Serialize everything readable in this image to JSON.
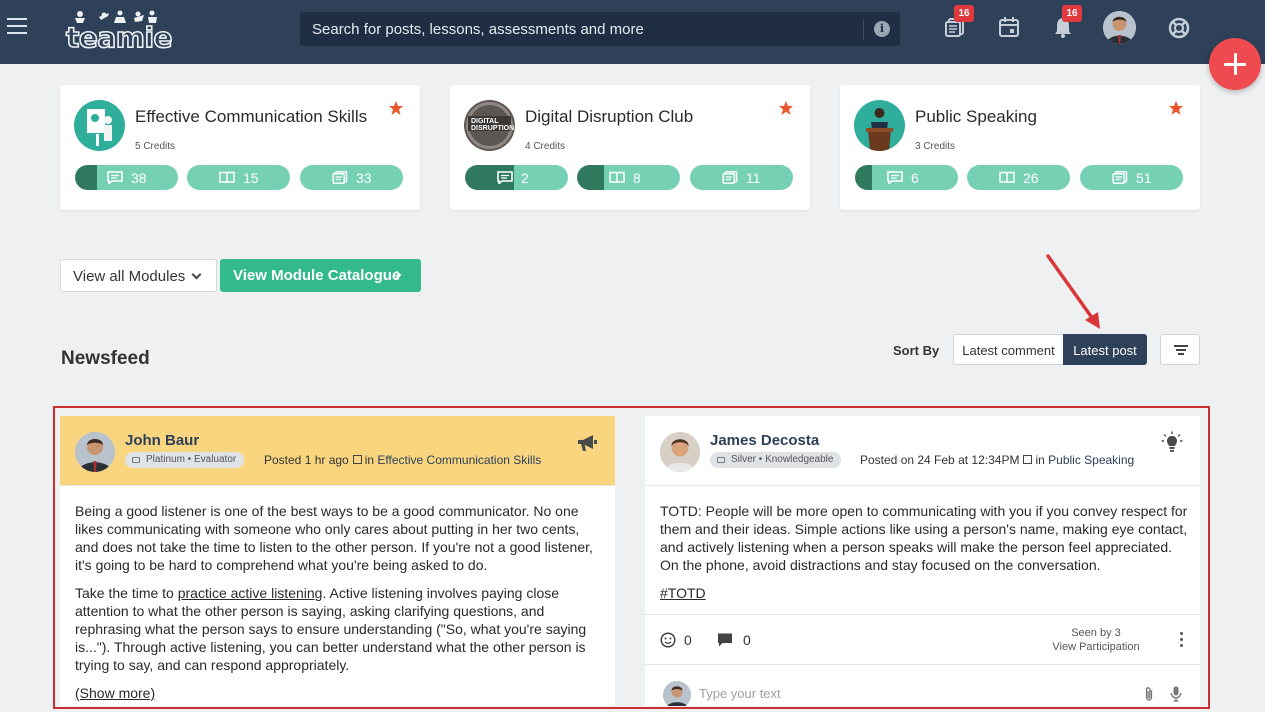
{
  "app": {
    "logo_text": "teamie"
  },
  "topbar": {
    "search_placeholder": "Search for posts, lessons, assessments and more",
    "posts_badge": "16",
    "notifications_badge": "16"
  },
  "modules": [
    {
      "title": "Effective Communication Skills",
      "credits": "5 Credits",
      "posts": "38",
      "lessons": "15",
      "assessments": "33"
    },
    {
      "title": "Digital Disruption Club",
      "credits": "4 Credits",
      "posts": "2",
      "lessons": "8",
      "assessments": "11",
      "thumb_text": "DIGITAL DISRUPTION"
    },
    {
      "title": "Public Speaking",
      "credits": "3 Credits",
      "posts": "6",
      "lessons": "26",
      "assessments": "51"
    }
  ],
  "module_actions": {
    "view_all": "View all Modules",
    "catalogue": "View Module Catalogue"
  },
  "newsfeed": {
    "title": "Newsfeed",
    "sort_label": "Sort By",
    "sort_options": [
      "Latest comment",
      "Latest post"
    ],
    "selected_sort": "Latest post"
  },
  "posts": [
    {
      "author": "John Baur",
      "tier": "Platinum",
      "role": "Evaluator",
      "posted": "Posted 1 hr ago",
      "in_label": "in",
      "module": "Effective Communication Skills",
      "para1": "Being a good listener is one of the best ways to be a good communicator. No one likes communicating with someone who only cares about putting in her two cents, and does not take the time to listen to the other person. If you're not a good listener, it's going to be hard to comprehend what you're being asked to do.",
      "para2_pre": "Take the time to ",
      "para2_link": "practice active listening",
      "para2_post": ". Active listening involves paying close attention to what the other person is saying, asking clarifying questions, and rephrasing what the person says to ensure understanding (\"So, what you're saying is...\"). Through active listening, you can better understand what the other person is trying to say, and can respond appropriately.",
      "show_more": "(Show more)"
    },
    {
      "author": "James Decosta",
      "tier": "Silver",
      "role": "Knowledgeable",
      "posted": "Posted on 24 Feb at 12:34PM",
      "in_label": "in",
      "module": "Public Speaking",
      "body": "TOTD: People will be more open to communicating with you if you convey respect for them and their ideas. Simple actions like using a person's name, making eye contact, and actively listening when a person speaks will make the person feel appreciated. On the phone, avoid distractions and stay focused on the conversation.",
      "hashtag": "#TOTD",
      "reactions": "0",
      "comments": "0",
      "seen_by": "Seen by 3",
      "view_participation": "View Participation",
      "comment_placeholder": "Type your text"
    }
  ],
  "colors": {
    "topbar": "#2e4159",
    "accent_green": "#32b98c",
    "stat_green": "#76d0b3",
    "badge_red": "#e0393e",
    "fab_red": "#ef4a4f",
    "announcement_bg": "#f8d57e",
    "annotation_red": "#cc2f2f"
  },
  "icons": [
    "menu-icon",
    "info-icon",
    "posts-icon",
    "calendar-icon",
    "bell-icon",
    "help-lifebuoy-icon",
    "plus-icon",
    "star-icon",
    "comment-icon",
    "book-icon",
    "assessment-icon",
    "megaphone-icon",
    "lightbulb-icon",
    "smiley-icon",
    "chat-icon",
    "paperclip-icon",
    "mic-icon",
    "filter-icon"
  ]
}
